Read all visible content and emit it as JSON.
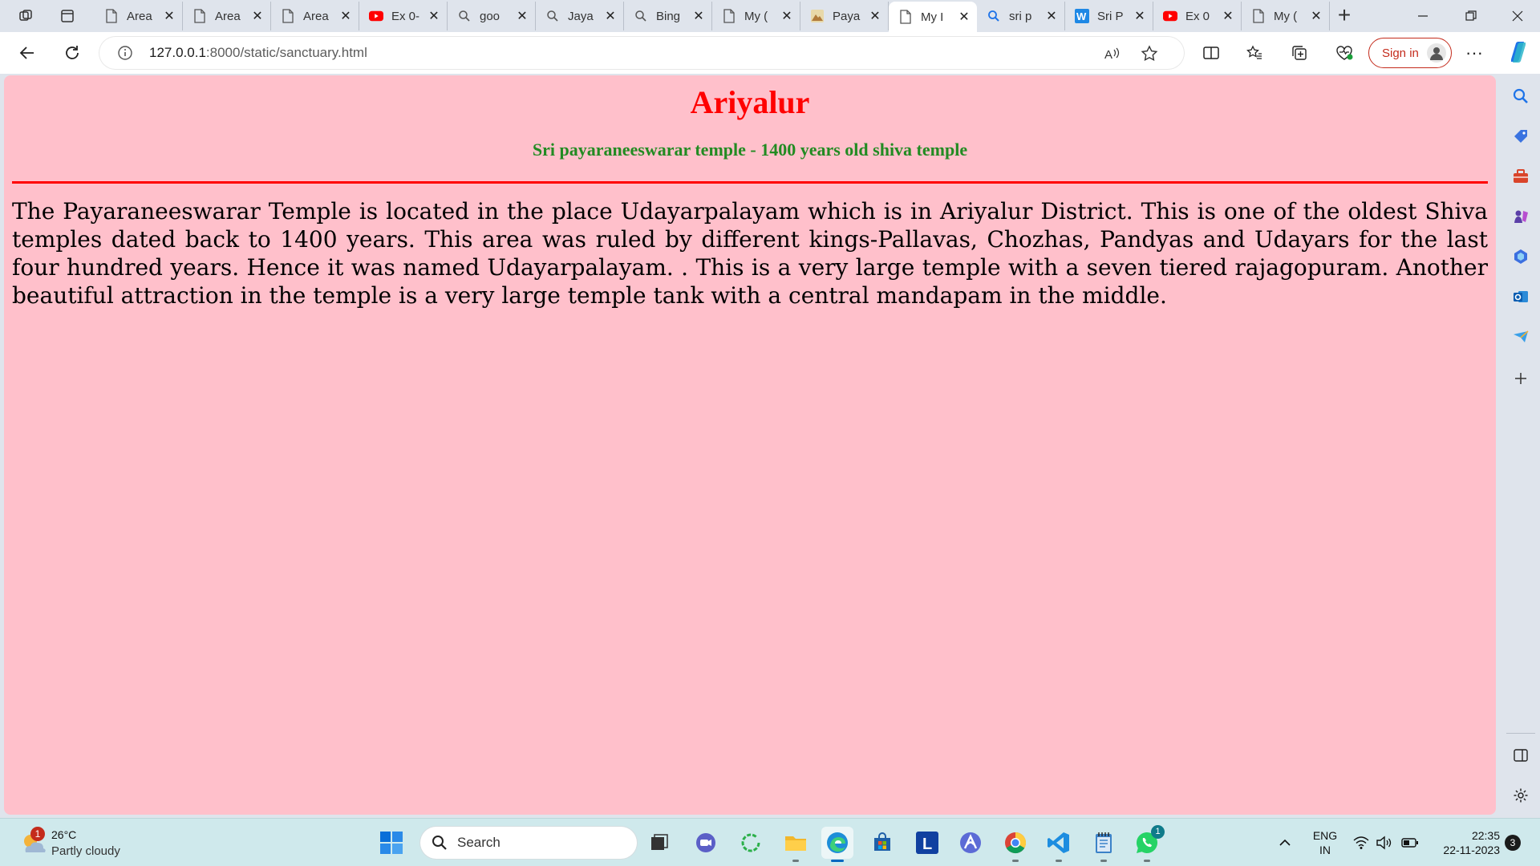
{
  "browser": {
    "tabs": [
      {
        "title": "Area",
        "icon": "page-icon"
      },
      {
        "title": "Area",
        "icon": "page-icon"
      },
      {
        "title": "Area",
        "icon": "page-icon"
      },
      {
        "title": "Ex 0-",
        "icon": "youtube-icon"
      },
      {
        "title": "goo",
        "icon": "search-icon"
      },
      {
        "title": "Jaya",
        "icon": "search-icon"
      },
      {
        "title": "Bing",
        "icon": "search-icon"
      },
      {
        "title": "My (",
        "icon": "page-icon"
      },
      {
        "title": "Paya",
        "icon": "image-icon"
      },
      {
        "title": "My I",
        "icon": "page-icon",
        "active": true
      },
      {
        "title": "sri p",
        "icon": "bing-search-icon"
      },
      {
        "title": "Sri P",
        "icon": "wikipedia-icon"
      },
      {
        "title": "Ex 0",
        "icon": "youtube-icon"
      },
      {
        "title": "My (",
        "icon": "page-icon"
      }
    ],
    "address": {
      "host": "127.0.0.1",
      "path": ":8000/static/sanctuary.html"
    },
    "sign_in_label": "Sign in",
    "accent_color": "#c42b1c"
  },
  "page": {
    "background": "#ffc0cb",
    "heading": "Ariyalur",
    "subheading": "Sri payaraneeswarar temple - 1400 years old shiva temple",
    "paragraph": "The Payaraneeswarar Temple is located in the place Udayarpalayam which is in Ariyalur District. This is one of the oldest Shiva temples dated back to 1400 years. This area was ruled by different kings-Pallavas, Chozhas, Pandyas and Udayars for the last four hundred years. Hence it was named Udayarpalayam. . This is a very large temple with a seven tiered rajagopuram. Another beautiful attraction in the temple is a very large temple tank with a central mandapam in the middle.",
    "heading_color": "#ff0000",
    "subheading_color": "#228b22"
  },
  "taskbar": {
    "weather": {
      "temp": "26°C",
      "condition": "Partly cloudy",
      "badge": "1"
    },
    "search_label": "Search",
    "whatsapp_badge": "1",
    "lang_line1": "ENG",
    "lang_line2": "IN",
    "time": "22:35",
    "date": "22-11-2023",
    "notification_count": "3"
  }
}
